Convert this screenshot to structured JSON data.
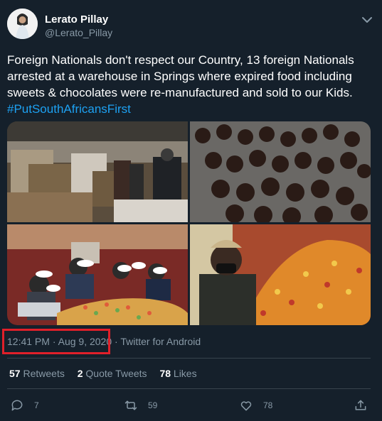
{
  "user": {
    "name": "Lerato Pillay",
    "handle": "@Lerato_Pillay"
  },
  "tweet": {
    "text": "Foreign Nationals don't respect our Country, 13 foreign Nationals arrested at a warehouse in Springs where expired food including sweets & chocolates were re-manufactured and sold to our Kids.",
    "hashtag": "#PutSouthAfricansFirst"
  },
  "meta": {
    "time": "12:41 PM",
    "sep": " · ",
    "date": "Aug 9, 2020",
    "source": "Twitter for Android"
  },
  "stats": {
    "retweets_count": "57",
    "retweets_label": "Retweets",
    "quotes_count": "2",
    "quotes_label": "Quote Tweets",
    "likes_count": "78",
    "likes_label": "Likes"
  },
  "actions": {
    "reply_count": "7",
    "retweet_count": "59",
    "like_count": "78"
  },
  "colors": {
    "background": "#15202b",
    "secondary_text": "#8899a6",
    "link": "#1da1f2",
    "highlight_box": "#e0202a"
  },
  "icons": [
    "chevron-down-icon",
    "reply-icon",
    "retweet-icon",
    "like-icon",
    "share-icon"
  ]
}
